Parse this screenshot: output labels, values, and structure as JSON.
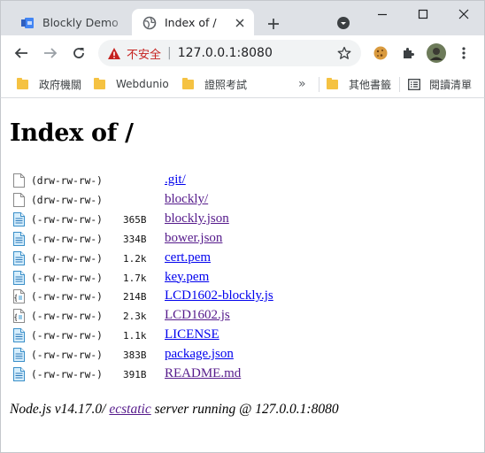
{
  "browser": {
    "tabs": [
      {
        "title": "Blockly Demo",
        "active": false,
        "favicon": "blockly-puzzle-icon"
      },
      {
        "title": "Index of /",
        "active": true,
        "favicon": "globe-icon"
      }
    ],
    "omnibox": {
      "security_label": "不安全",
      "url": "127.0.0.1:8080"
    },
    "bookmarks": [
      {
        "label": "政府機關",
        "icon": "folder-icon"
      },
      {
        "label": "Webdunio",
        "icon": "folder-icon"
      },
      {
        "label": "證照考試",
        "icon": "folder-icon"
      },
      {
        "label": "其他書籤",
        "icon": "folder-icon"
      },
      {
        "label": "閱讀清單",
        "icon": "reading-list-icon"
      }
    ],
    "overflow_label": "»"
  },
  "page": {
    "title": "Index of /",
    "files": [
      {
        "icon": "blank-file-icon",
        "perms": "(drw-rw-rw-)",
        "size": "",
        "name": ".git/",
        "visited": false
      },
      {
        "icon": "blank-file-icon",
        "perms": "(drw-rw-rw-)",
        "size": "",
        "name": "blockly/",
        "visited": true
      },
      {
        "icon": "text-file-icon",
        "perms": "(-rw-rw-rw-)",
        "size": "365B",
        "name": "blockly.json",
        "visited": true
      },
      {
        "icon": "text-file-icon",
        "perms": "(-rw-rw-rw-)",
        "size": "334B",
        "name": "bower.json",
        "visited": true
      },
      {
        "icon": "text-file-icon",
        "perms": "(-rw-rw-rw-)",
        "size": "1.2k",
        "name": "cert.pem",
        "visited": false
      },
      {
        "icon": "text-file-icon",
        "perms": "(-rw-rw-rw-)",
        "size": "1.7k",
        "name": "key.pem",
        "visited": false
      },
      {
        "icon": "script-file-icon",
        "perms": "(-rw-rw-rw-)",
        "size": "214B",
        "name": "LCD1602-blockly.js",
        "visited": false
      },
      {
        "icon": "script-file-icon",
        "perms": "(-rw-rw-rw-)",
        "size": "2.3k",
        "name": "LCD1602.js",
        "visited": true
      },
      {
        "icon": "text-file-icon",
        "perms": "(-rw-rw-rw-)",
        "size": "1.1k",
        "name": "LICENSE",
        "visited": false
      },
      {
        "icon": "text-file-icon",
        "perms": "(-rw-rw-rw-)",
        "size": "383B",
        "name": "package.json",
        "visited": false
      },
      {
        "icon": "text-file-icon",
        "perms": "(-rw-rw-rw-)",
        "size": "391B",
        "name": "README.md",
        "visited": true
      }
    ],
    "footer": {
      "prefix": "Node.js v14.17.0/ ",
      "link": "ecstatic",
      "suffix": " server running @ 127.0.0.1:8080"
    }
  },
  "colors": {
    "link": "#0000ee",
    "visited": "#551a8b",
    "warning": "#c5221f",
    "folder": "#f5c242"
  }
}
